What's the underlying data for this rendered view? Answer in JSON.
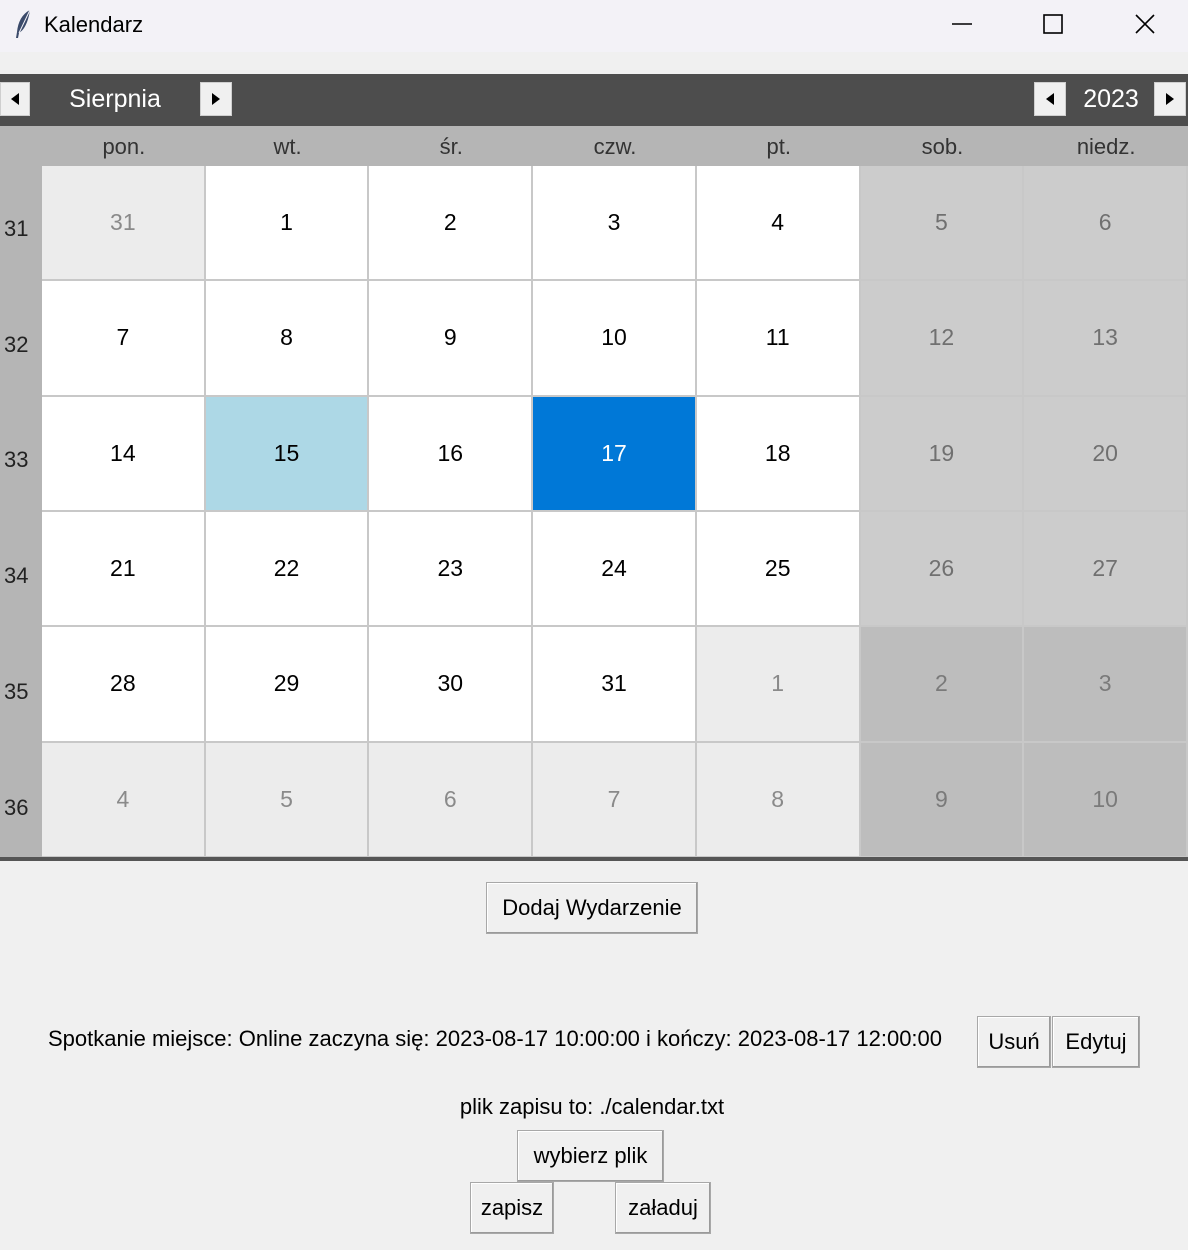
{
  "window": {
    "title": "Kalendarz"
  },
  "header": {
    "month": "Sierpnia",
    "year": "2023"
  },
  "calendar": {
    "day_names": [
      "pon.",
      "wt.",
      "śr.",
      "czw.",
      "pt.",
      "sob.",
      "niedz."
    ],
    "weeks": [
      {
        "number": "31",
        "days": [
          {
            "day": "31",
            "type": "othermonth"
          },
          {
            "day": "1",
            "type": "normal"
          },
          {
            "day": "2",
            "type": "normal"
          },
          {
            "day": "3",
            "type": "normal"
          },
          {
            "day": "4",
            "type": "normal"
          },
          {
            "day": "5",
            "type": "weekend"
          },
          {
            "day": "6",
            "type": "weekend"
          }
        ]
      },
      {
        "number": "32",
        "days": [
          {
            "day": "7",
            "type": "normal"
          },
          {
            "day": "8",
            "type": "normal"
          },
          {
            "day": "9",
            "type": "normal"
          },
          {
            "day": "10",
            "type": "normal"
          },
          {
            "day": "11",
            "type": "normal"
          },
          {
            "day": "12",
            "type": "weekend"
          },
          {
            "day": "13",
            "type": "weekend"
          }
        ]
      },
      {
        "number": "33",
        "days": [
          {
            "day": "14",
            "type": "normal"
          },
          {
            "day": "15",
            "type": "highlight"
          },
          {
            "day": "16",
            "type": "normal"
          },
          {
            "day": "17",
            "type": "selected"
          },
          {
            "day": "18",
            "type": "normal"
          },
          {
            "day": "19",
            "type": "weekend"
          },
          {
            "day": "20",
            "type": "weekend"
          }
        ]
      },
      {
        "number": "34",
        "days": [
          {
            "day": "21",
            "type": "normal"
          },
          {
            "day": "22",
            "type": "normal"
          },
          {
            "day": "23",
            "type": "normal"
          },
          {
            "day": "24",
            "type": "normal"
          },
          {
            "day": "25",
            "type": "normal"
          },
          {
            "day": "26",
            "type": "weekend"
          },
          {
            "day": "27",
            "type": "weekend"
          }
        ]
      },
      {
        "number": "35",
        "days": [
          {
            "day": "28",
            "type": "normal"
          },
          {
            "day": "29",
            "type": "normal"
          },
          {
            "day": "30",
            "type": "normal"
          },
          {
            "day": "31",
            "type": "normal"
          },
          {
            "day": "1",
            "type": "othermonth"
          },
          {
            "day": "2",
            "type": "weekend-other"
          },
          {
            "day": "3",
            "type": "weekend-other"
          }
        ]
      },
      {
        "number": "36",
        "days": [
          {
            "day": "4",
            "type": "othermonth"
          },
          {
            "day": "5",
            "type": "othermonth"
          },
          {
            "day": "6",
            "type": "othermonth"
          },
          {
            "day": "7",
            "type": "othermonth"
          },
          {
            "day": "8",
            "type": "othermonth"
          },
          {
            "day": "9",
            "type": "weekend-other"
          },
          {
            "day": "10",
            "type": "weekend-other"
          }
        ]
      }
    ]
  },
  "controls": {
    "add_event_label": "Dodaj Wydarzenie",
    "event_text": "Spotkanie miejsce: Online zaczyna się: 2023-08-17 10:00:00 i kończy: 2023-08-17 12:00:00",
    "delete_label": "Usuń",
    "edit_label": "Edytuj",
    "file_label": "plik zapisu to: ./calendar.txt",
    "choose_file_label": "wybierz plik",
    "save_label": "zapisz",
    "load_label": "załaduj"
  },
  "colors": {
    "header_bg": "#4d4d4d",
    "selected_day": "#0078d7",
    "highlighted_day": "#add8e6"
  },
  "icons": [
    "feather-icon",
    "minimize-icon",
    "maximize-icon",
    "close-icon",
    "chevron-left-icon",
    "chevron-right-icon"
  ]
}
